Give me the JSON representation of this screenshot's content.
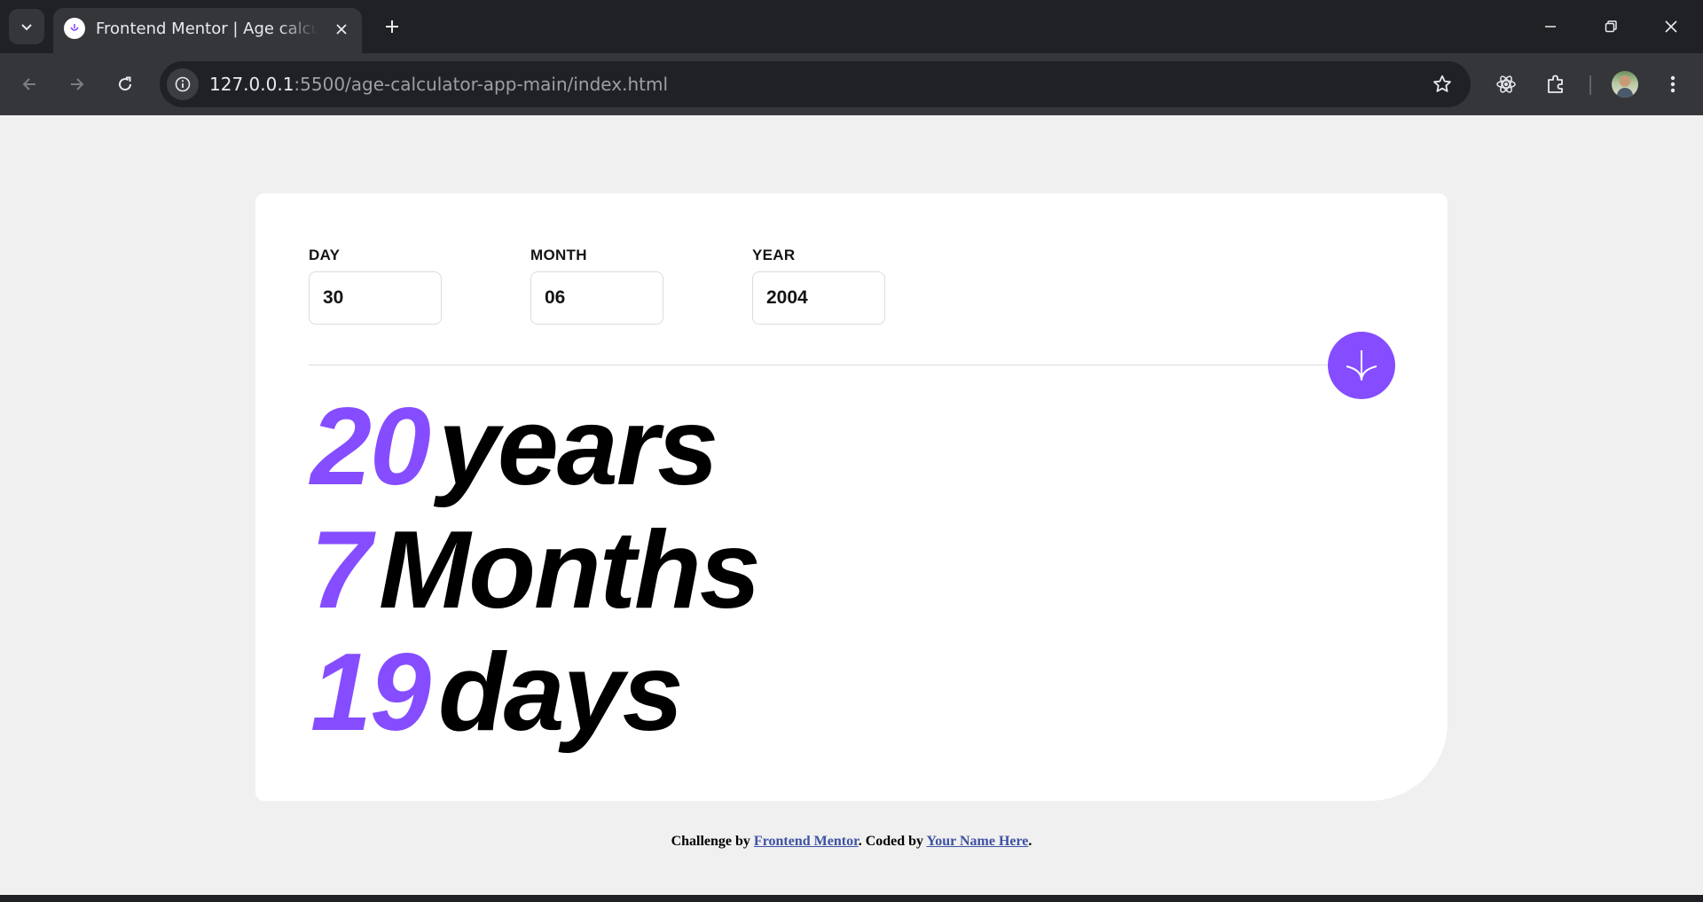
{
  "browser": {
    "tab_title": "Frontend Mentor | Age calculator app",
    "url_host": "127.0.0.1",
    "url_rest": ":5500/age-calculator-app-main/index.html"
  },
  "form": {
    "day": {
      "label": "DAY",
      "value": "30"
    },
    "month": {
      "label": "MONTH",
      "value": "06"
    },
    "year": {
      "label": "YEAR",
      "value": "2004"
    }
  },
  "results": {
    "years": {
      "value": "20",
      "unit": "years"
    },
    "months": {
      "value": "7",
      "unit": "Months"
    },
    "days": {
      "value": "19",
      "unit": "days"
    }
  },
  "attribution": {
    "prefix": "Challenge by",
    "link1": "Frontend Mentor",
    "middle": ". Coded by",
    "link2": "Your Name Here",
    "suffix": "."
  },
  "colors": {
    "accent": "#854dff",
    "card": "#ffffff",
    "background": "#f0f0f0",
    "text": "#000000",
    "link": "#3e52a3"
  },
  "icons": {
    "submit": "arrow-down-icon",
    "favicon": "frontend-mentor-favicon-icon"
  }
}
